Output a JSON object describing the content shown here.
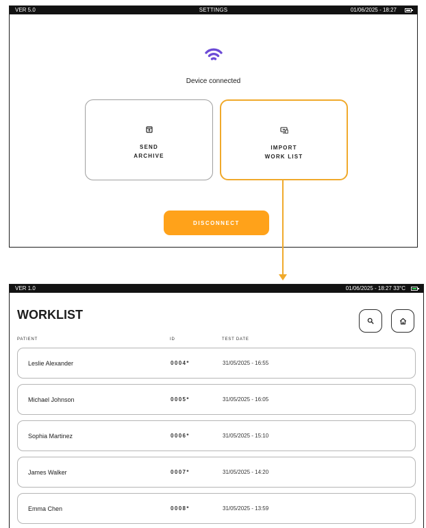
{
  "settings_screen": {
    "version": "VER 5.0",
    "title": "SETTINGS",
    "datetime": "01/06/2025 - 18:27",
    "status": "Device connected",
    "send_archive": {
      "line1": "SEND",
      "line2": "ARCHIVE",
      "icon": "archive-upload-icon"
    },
    "import_worklist": {
      "line1": "IMPORT",
      "line2": "WORK LIST",
      "icon": "import-screen-icon"
    },
    "disconnect_label": "DISCONNECT",
    "wifi_color": "#6c4bd6",
    "highlight_color": "#f0a92a",
    "button_color": "#ffa21a"
  },
  "worklist_screen": {
    "version": "VER 1.0",
    "datetime_temp": "01/06/2025 - 18:27  33°C",
    "title": "WORKLIST",
    "columns": {
      "patient": "PATIENT",
      "id": "ID",
      "test_date": "TEST DATE"
    },
    "rows": [
      {
        "patient": "Leslie Alexander",
        "id": "0004*",
        "date": "31/05/2025 - 16:55"
      },
      {
        "patient": "Michael Johnson",
        "id": "0005*",
        "date": "31/05/2025 - 16:05"
      },
      {
        "patient": "Sophia Martinez",
        "id": "0006*",
        "date": "31/05/2025 - 15:10"
      },
      {
        "patient": "James Walker",
        "id": "0007*",
        "date": "31/05/2025 - 14:20"
      },
      {
        "patient": "Emma Chen",
        "id": "0008*",
        "date": "31/05/2025 - 13:59"
      }
    ],
    "battery_color": "#34d058"
  }
}
